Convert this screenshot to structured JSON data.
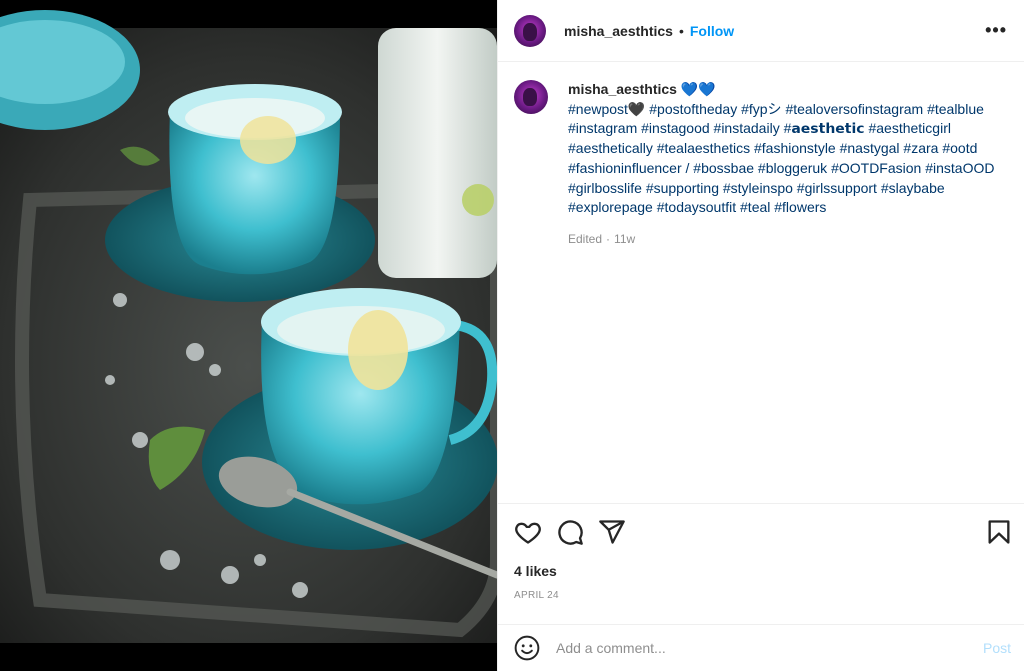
{
  "post": {
    "image_alt": "Teal glass cups with lemon slices and crushed ice on a dark tray"
  },
  "header": {
    "username": "misha_aesthtics",
    "separator": "•",
    "follow_label": "Follow",
    "more_label": "•••"
  },
  "caption": {
    "username": "misha_aesthtics",
    "hearts": "💙💙",
    "text": "#newpost🖤 #postoftheday #fypシ #tealoversofinstagram #tealblue #instagram #instagood #instadaily #𝗮𝗲𝘀𝘁𝗵𝗲𝘁𝗶𝗰 #aestheticgirl #aesthetically #tealaesthetics #fashionstyle #nastygal #zara #ootd #fashioninfluencer / #bossbae #bloggeruk #OOTDFasion #instaOOD #girlbosslife #supporting #styleinspo #girlssupport #slaybabe #explorepage #todaysoutfit #teal #flowers",
    "edited": "Edited",
    "dot": "·",
    "age": "11w"
  },
  "stats": {
    "likes": "4 likes",
    "date": "APRIL 24"
  },
  "comment": {
    "placeholder": "Add a comment...",
    "post_label": "Post"
  },
  "colors": {
    "accent": "#0095f6",
    "link": "#00376b",
    "muted": "#8e8e8e",
    "post_disabled": "#b2dffc"
  }
}
